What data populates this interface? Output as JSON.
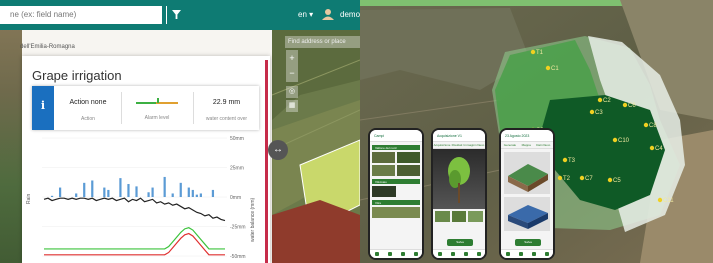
{
  "app": {
    "search_placeholder": "ne (ex: field name)",
    "language": "en ▾",
    "user_name": "demo",
    "region": "dell'Emilia-Romagna"
  },
  "panel": {
    "title": "Grape irrigation",
    "action_value": "Action none",
    "action_label": "Action",
    "alarm_label": "Alarm level",
    "water_value": "22.9 mm",
    "water_label": "water content over"
  },
  "chart_data": {
    "type": "bar",
    "ylabel": "water balance (mm)",
    "y_ticks": [
      "50mm",
      "25mm",
      "0mm",
      "-25mm",
      "-50mm"
    ],
    "ylim": [
      -50,
      50
    ],
    "rain_label": "Rain",
    "x_count": 46,
    "series": [
      {
        "kind": "bar",
        "color": "#5b9bd5",
        "values": [
          0,
          0,
          1,
          0,
          8,
          0,
          0,
          0,
          3,
          0,
          12,
          0,
          14,
          0,
          0,
          8,
          6,
          0,
          0,
          16,
          0,
          11,
          0,
          9,
          0,
          0,
          4,
          8,
          0,
          0,
          17,
          0,
          3,
          0,
          12,
          0,
          8,
          6,
          2,
          3,
          0,
          0,
          6,
          0,
          0,
          0
        ]
      },
      {
        "kind": "line",
        "color": "#222222",
        "values": [
          -2,
          -1,
          -3,
          -2,
          -1,
          -1,
          -2,
          -1,
          -2,
          -1,
          -1,
          -2,
          -1,
          -3,
          -2,
          -1,
          -2,
          -1,
          -3,
          -2,
          -1,
          -4,
          -2,
          -3,
          -1,
          -4,
          -3,
          -2,
          -5,
          -4,
          -6,
          -5,
          -7,
          -6,
          -8,
          -10,
          -9,
          -11,
          -13,
          -14,
          -16,
          -15,
          -18,
          -17,
          -19,
          -20
        ]
      },
      {
        "kind": "line",
        "color": "#3cc33c",
        "values": [
          -44,
          -44,
          -44,
          -44,
          -44,
          -44,
          -44,
          -44,
          -44,
          -44,
          -44,
          -44,
          -44,
          -44,
          -44,
          -44,
          -44,
          -44,
          -44,
          -44,
          -44,
          -44,
          -44,
          -44,
          -44,
          -44,
          -44,
          -44,
          -44,
          -44,
          -44,
          -42,
          -38,
          -34,
          -30,
          -27,
          -26,
          -28,
          -32,
          -36,
          -40,
          -44,
          -44,
          -44,
          -44,
          -44
        ]
      },
      {
        "kind": "line",
        "color": "#e03030",
        "values": [
          -49,
          -49,
          -49,
          -49,
          -49,
          -49,
          -49,
          -49,
          -49,
          -49,
          -49,
          -49,
          -49,
          -49,
          -49,
          -49,
          -49,
          -49,
          -49,
          -49,
          -49,
          -49,
          -49,
          -49,
          -49,
          -49,
          -49,
          -49,
          -49,
          -49,
          -49,
          -47,
          -43,
          -39,
          -35,
          -32,
          -31,
          -33,
          -37,
          -41,
          -45,
          -49,
          -49,
          -49,
          -49,
          -49
        ]
      }
    ]
  },
  "map": {
    "search_placeholder": "Find address or place",
    "zoom_in": "+",
    "zoom_out": "−",
    "expand_icon": "↔"
  },
  "field_labels": [
    "T1",
    "C1",
    "C2",
    "C3",
    "C4",
    "T2",
    "C5",
    "C6",
    "C7",
    "C8",
    "C9",
    "C10",
    "T3",
    "C11"
  ],
  "phones": [
    {
      "title": "Campi",
      "sections": [
        "Vallone del nord",
        "Vitivivaio",
        "Vitre"
      ]
    },
    {
      "title": "Acquisizione V1",
      "tabs": [
        "Acquisizione",
        "Risultati",
        "Immagini rilievo"
      ],
      "button": "Salva"
    },
    {
      "title": "23 Agosto 2023",
      "tabs": [
        "Generale",
        "Mappa",
        "Dati rilievo"
      ],
      "button": "Salva"
    }
  ]
}
